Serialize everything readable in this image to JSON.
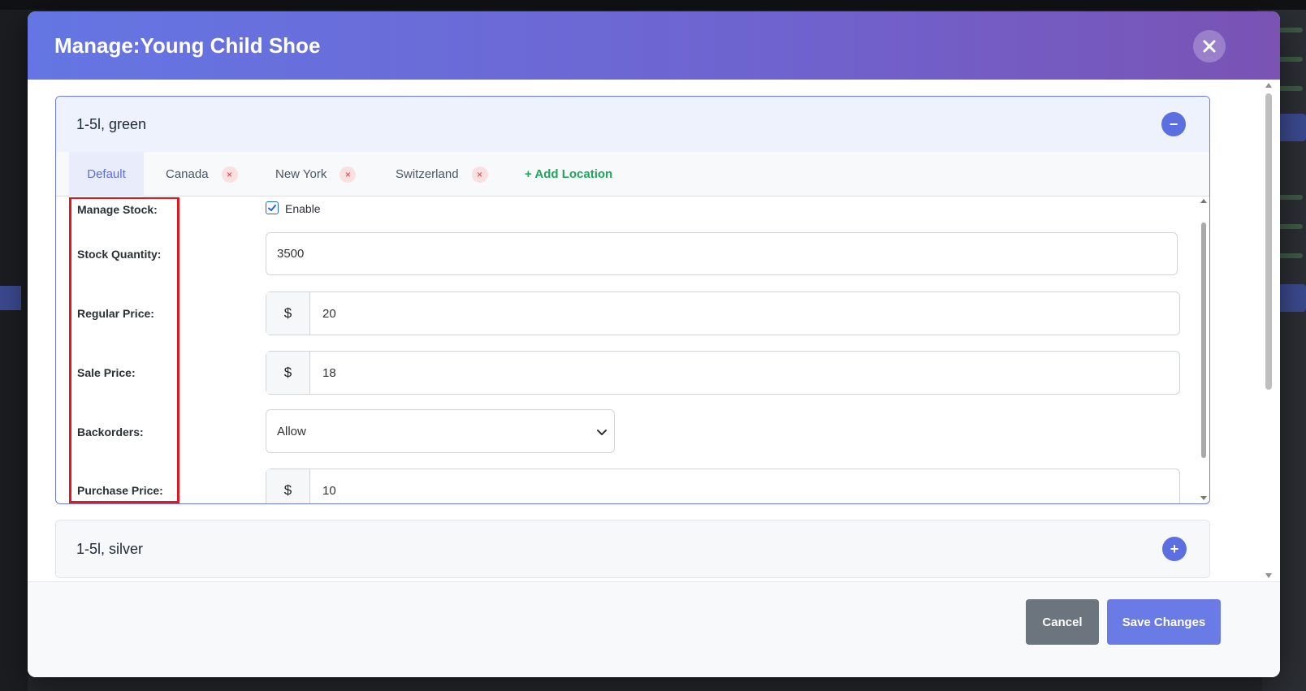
{
  "modal": {
    "title": "Manage:Young Child Shoe",
    "close_icon": "close-icon"
  },
  "variations": [
    {
      "title": "1-5l, green",
      "expanded": true,
      "toggle_symbol": "−",
      "tabs": [
        {
          "label": "Default",
          "active": true,
          "removable": false
        },
        {
          "label": "Canada",
          "active": false,
          "removable": true
        },
        {
          "label": "New York",
          "active": false,
          "removable": true
        },
        {
          "label": "Switzerland",
          "active": false,
          "removable": true
        }
      ],
      "tab_remove_symbol": "×",
      "add_location_label": "+ Add Location",
      "form": {
        "manage_stock_label": "Manage Stock:",
        "manage_stock_enabled": true,
        "enable_label": "Enable",
        "stock_quantity_label": "Stock Quantity:",
        "stock_quantity_value": "3500",
        "regular_price_label": "Regular Price:",
        "regular_price_value": "20",
        "sale_price_label": "Sale Price:",
        "sale_price_value": "18",
        "backorders_label": "Backorders:",
        "backorders_value": "Allow",
        "purchase_price_label": "Purchase Price:",
        "purchase_price_value": "10",
        "currency_symbol": "$"
      }
    },
    {
      "title": "1-5l, silver",
      "expanded": false,
      "toggle_symbol": "+"
    }
  ],
  "footer": {
    "cancel_label": "Cancel",
    "save_label": "Save Changes"
  },
  "colors": {
    "accent": "#5c6fe0",
    "header_gradient_start": "#6476e3",
    "header_gradient_end": "#7a53b4",
    "add_location": "#22a45d",
    "remove_badge": "#dc3545",
    "highlight": "#e3171f",
    "cancel_button": "#6c757d"
  }
}
